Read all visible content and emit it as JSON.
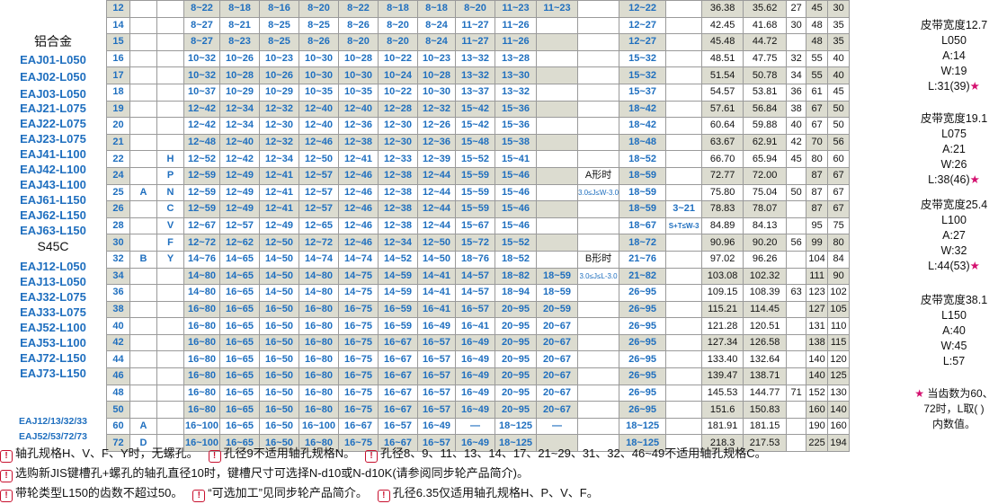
{
  "left_labels": {
    "alloy": "铝合金",
    "alloy_codes": [
      "EAJ01-L050",
      "EAJ02-L050",
      "EAJ03-L050",
      "EAJ21-L075",
      "EAJ22-L075",
      "EAJ23-L075",
      "EAJ41-L100",
      "EAJ42-L100",
      "EAJ43-L100",
      "EAJ61-L150",
      "EAJ62-L150",
      "EAJ63-L150"
    ],
    "steel": "S45C",
    "steel_codes": [
      "EAJ12-L050",
      "EAJ13-L050",
      "EAJ32-L075",
      "EAJ33-L075",
      "EAJ52-L100",
      "EAJ53-L100",
      "EAJ72-L150",
      "EAJ73-L150"
    ],
    "group1": "EAJ12/13/32/33",
    "group2": "EAJ52/53/72/73"
  },
  "table": {
    "shape_letters": [
      "A",
      "B"
    ],
    "hole_letters": [
      "H",
      "P",
      "N",
      "C",
      "V",
      "F",
      "Y"
    ],
    "a_shape": "A形时",
    "a_shape_cond": "3.0≤J≤W-3.0",
    "b_shape": "B形时",
    "b_shape_cond": "3.0≤J≤L-3.0",
    "t_range": "3~21",
    "t_cond": "S+T≤W-3",
    "dash": "—",
    "rows": [
      {
        "z": "12",
        "c": [
          "8~22",
          "8~18",
          "8~16",
          "8~20",
          "8~22",
          "8~18",
          "8~18",
          "8~20",
          "11~23",
          "11~23"
        ],
        "r": "12~22",
        "d1": "36.38",
        "d2": "35.62",
        "e": "27",
        "f": "45",
        "g": "30"
      },
      {
        "z": "14",
        "c": [
          "8~27",
          "8~21",
          "8~25",
          "8~25",
          "8~26",
          "8~20",
          "8~24",
          "11~27",
          "11~26"
        ],
        "r": "12~27",
        "d1": "42.45",
        "d2": "41.68",
        "e": "30",
        "f": "48",
        "g": "35"
      },
      {
        "z": "15",
        "c": [
          "8~27",
          "8~23",
          "8~25",
          "8~26",
          "8~20",
          "8~20",
          "8~24",
          "11~27",
          "11~26"
        ],
        "r": "12~27",
        "d1": "45.48",
        "d2": "44.72",
        "e": "",
        "f": "48",
        "g": "35"
      },
      {
        "z": "16",
        "c": [
          "10~32",
          "10~26",
          "10~23",
          "10~30",
          "10~28",
          "10~22",
          "10~23",
          "13~32",
          "13~28"
        ],
        "r": "15~32",
        "d1": "48.51",
        "d2": "47.75",
        "e": "32",
        "f": "55",
        "g": "40"
      },
      {
        "z": "17",
        "c": [
          "10~32",
          "10~28",
          "10~26",
          "10~30",
          "10~30",
          "10~24",
          "10~28",
          "13~32",
          "13~30"
        ],
        "r": "15~32",
        "d1": "51.54",
        "d2": "50.78",
        "e": "34",
        "f": "55",
        "g": "40"
      },
      {
        "z": "18",
        "c": [
          "10~37",
          "10~29",
          "10~29",
          "10~35",
          "10~35",
          "10~22",
          "10~30",
          "13~37",
          "13~32"
        ],
        "r": "15~37",
        "d1": "54.57",
        "d2": "53.81",
        "e": "36",
        "f": "61",
        "g": "45"
      },
      {
        "z": "19",
        "c": [
          "12~42",
          "12~34",
          "12~32",
          "12~40",
          "12~40",
          "12~28",
          "12~32",
          "15~42",
          "15~36"
        ],
        "r": "18~42",
        "d1": "57.61",
        "d2": "56.84",
        "e": "38",
        "f": "67",
        "g": "50"
      },
      {
        "z": "20",
        "c": [
          "12~42",
          "12~34",
          "12~30",
          "12~40",
          "12~36",
          "12~30",
          "12~26",
          "15~42",
          "15~36"
        ],
        "r": "18~42",
        "d1": "60.64",
        "d2": "59.88",
        "e": "40",
        "f": "67",
        "g": "50"
      },
      {
        "z": "21",
        "c": [
          "12~48",
          "12~40",
          "12~32",
          "12~46",
          "12~38",
          "12~30",
          "12~36",
          "15~48",
          "15~38"
        ],
        "r": "18~48",
        "d1": "63.67",
        "d2": "62.91",
        "e": "42",
        "f": "70",
        "g": "56"
      },
      {
        "z": "22",
        "c": [
          "12~52",
          "12~42",
          "12~34",
          "12~50",
          "12~41",
          "12~33",
          "12~39",
          "15~52",
          "15~41"
        ],
        "r": "18~52",
        "d1": "66.70",
        "d2": "65.94",
        "e": "45",
        "f": "80",
        "g": "60"
      },
      {
        "z": "24",
        "c": [
          "12~59",
          "12~49",
          "12~41",
          "12~57",
          "12~46",
          "12~38",
          "12~44",
          "15~59",
          "15~46"
        ],
        "r": "18~59",
        "d1": "72.77",
        "d2": "72.00",
        "e": "",
        "f": "87",
        "g": "67"
      },
      {
        "z": "25",
        "c": [
          "12~59",
          "12~49",
          "12~41",
          "12~57",
          "12~46",
          "12~38",
          "12~44",
          "15~59",
          "15~46"
        ],
        "r": "18~59",
        "d1": "75.80",
        "d2": "75.04",
        "e": "50",
        "f": "87",
        "g": "67"
      },
      {
        "z": "26",
        "c": [
          "12~59",
          "12~49",
          "12~41",
          "12~57",
          "12~46",
          "12~38",
          "12~44",
          "15~59",
          "15~46"
        ],
        "r": "18~59",
        "d1": "78.83",
        "d2": "78.07",
        "e": "",
        "f": "87",
        "g": "67"
      },
      {
        "z": "28",
        "c": [
          "12~67",
          "12~57",
          "12~49",
          "12~65",
          "12~46",
          "12~38",
          "12~44",
          "15~67",
          "15~46"
        ],
        "r": "18~67",
        "d1": "84.89",
        "d2": "84.13",
        "e": "",
        "f": "95",
        "g": "75"
      },
      {
        "z": "30",
        "c": [
          "12~72",
          "12~62",
          "12~50",
          "12~72",
          "12~46",
          "12~34",
          "12~50",
          "15~72",
          "15~52"
        ],
        "r": "18~72",
        "d1": "90.96",
        "d2": "90.20",
        "e": "56",
        "f": "99",
        "g": "80"
      },
      {
        "z": "32",
        "c": [
          "14~76",
          "14~65",
          "14~50",
          "14~74",
          "14~74",
          "14~52",
          "14~50",
          "18~76",
          "18~52"
        ],
        "r": "21~76",
        "d1": "97.02",
        "d2": "96.26",
        "e": "",
        "f": "104",
        "g": "84"
      },
      {
        "z": "34",
        "c": [
          "14~80",
          "14~65",
          "14~50",
          "14~80",
          "14~75",
          "14~59",
          "14~41",
          "14~57",
          "18~82",
          "18~59"
        ],
        "r": "21~82",
        "d1": "103.08",
        "d2": "102.32",
        "e": "",
        "f": "111",
        "g": "90"
      },
      {
        "z": "36",
        "c": [
          "14~80",
          "16~65",
          "14~50",
          "14~80",
          "14~75",
          "14~59",
          "14~41",
          "14~57",
          "18~94",
          "18~59"
        ],
        "r": "26~95",
        "d1": "109.15",
        "d2": "108.39",
        "e": "63",
        "f": "123",
        "g": "102"
      },
      {
        "z": "38",
        "c": [
          "16~80",
          "16~65",
          "16~50",
          "16~80",
          "16~75",
          "16~59",
          "16~41",
          "16~57",
          "20~95",
          "20~59"
        ],
        "r": "26~95",
        "d1": "115.21",
        "d2": "114.45",
        "e": "",
        "f": "127",
        "g": "105"
      },
      {
        "z": "40",
        "c": [
          "16~80",
          "16~65",
          "16~50",
          "16~80",
          "16~75",
          "16~59",
          "16~49",
          "16~41",
          "20~95",
          "20~67"
        ],
        "r": "26~95",
        "d1": "121.28",
        "d2": "120.51",
        "e": "",
        "f": "131",
        "g": "110"
      },
      {
        "z": "42",
        "c": [
          "16~80",
          "16~65",
          "16~50",
          "16~80",
          "16~75",
          "16~67",
          "16~57",
          "16~49",
          "20~95",
          "20~67"
        ],
        "r": "26~95",
        "d1": "127.34",
        "d2": "126.58",
        "e": "",
        "f": "138",
        "g": "115"
      },
      {
        "z": "44",
        "c": [
          "16~80",
          "16~65",
          "16~50",
          "16~80",
          "16~75",
          "16~67",
          "16~57",
          "16~49",
          "20~95",
          "20~67"
        ],
        "r": "26~95",
        "d1": "133.40",
        "d2": "132.64",
        "e": "",
        "f": "140",
        "g": "120"
      },
      {
        "z": "46",
        "c": [
          "16~80",
          "16~65",
          "16~50",
          "16~80",
          "16~75",
          "16~67",
          "16~57",
          "16~49",
          "20~95",
          "20~67"
        ],
        "r": "26~95",
        "d1": "139.47",
        "d2": "138.71",
        "e": "",
        "f": "140",
        "g": "125"
      },
      {
        "z": "48",
        "c": [
          "16~80",
          "16~65",
          "16~50",
          "16~80",
          "16~75",
          "16~67",
          "16~57",
          "16~49",
          "20~95",
          "20~67"
        ],
        "r": "26~95",
        "d1": "145.53",
        "d2": "144.77",
        "e": "71",
        "f": "152",
        "g": "130"
      },
      {
        "z": "50",
        "c": [
          "16~80",
          "16~65",
          "16~50",
          "16~80",
          "16~75",
          "16~67",
          "16~57",
          "16~49",
          "20~95",
          "20~67"
        ],
        "r": "26~95",
        "d1": "151.6",
        "d2": "150.83",
        "e": "",
        "f": "160",
        "g": "140"
      }
    ],
    "row60": {
      "z": "60",
      "s": "A",
      "c": [
        "16~100",
        "16~65",
        "16~50",
        "16~100",
        "16~67",
        "16~57",
        "16~49",
        "18~125"
      ],
      "r": "18~125",
      "d1": "181.91",
      "d2": "181.15",
      "f": "190",
      "g": "160"
    },
    "row72": {
      "z": "72",
      "s": "D",
      "c": [
        "16~100",
        "16~65",
        "16~50",
        "16~80",
        "16~75",
        "16~67",
        "16~57",
        "16~49",
        "18~125"
      ],
      "r": "18~125",
      "d1": "218.3",
      "d2": "217.53",
      "f": "225",
      "g": "194"
    }
  },
  "right_notes": {
    "b1": [
      "皮带宽度12.7",
      "L050",
      "A:14",
      "W:19",
      "L:31(39)"
    ],
    "b2": [
      "皮带宽度19.1",
      "L075",
      "A:21",
      "W:26",
      "L:38(46)"
    ],
    "b3": [
      "皮带宽度25.4",
      "L100",
      "A:27",
      "W:32",
      "L:44(53)"
    ],
    "b4": [
      "皮带宽度38.1",
      "L150",
      "A:40",
      "W:45",
      "L:57"
    ],
    "star": "★",
    "note": [
      "当齿数为60、",
      "72时，L取( )",
      "内数值。"
    ]
  },
  "footnotes": {
    "icon": "!",
    "l1a": "轴孔规格H、V、F、Y时，无螺孔。",
    "l1b": "孔径9不适用轴孔规格N。",
    "l1c": "孔径8、9、11、13、14、17、21~29、31、32、46~49不适用轴孔规格C。",
    "l2": "选购新JIS键槽孔+螺孔的轴孔直径10时，键槽尺寸可选择N-d10或N-d10K(请参阅同步轮产品简介)。",
    "l3a": "带轮类型L150的齿数不超过50。",
    "l3b": "“可选加工”见同步轮产品简介。",
    "l3c": "孔径6.35仅适用轴孔规格H、P、V、F。"
  }
}
